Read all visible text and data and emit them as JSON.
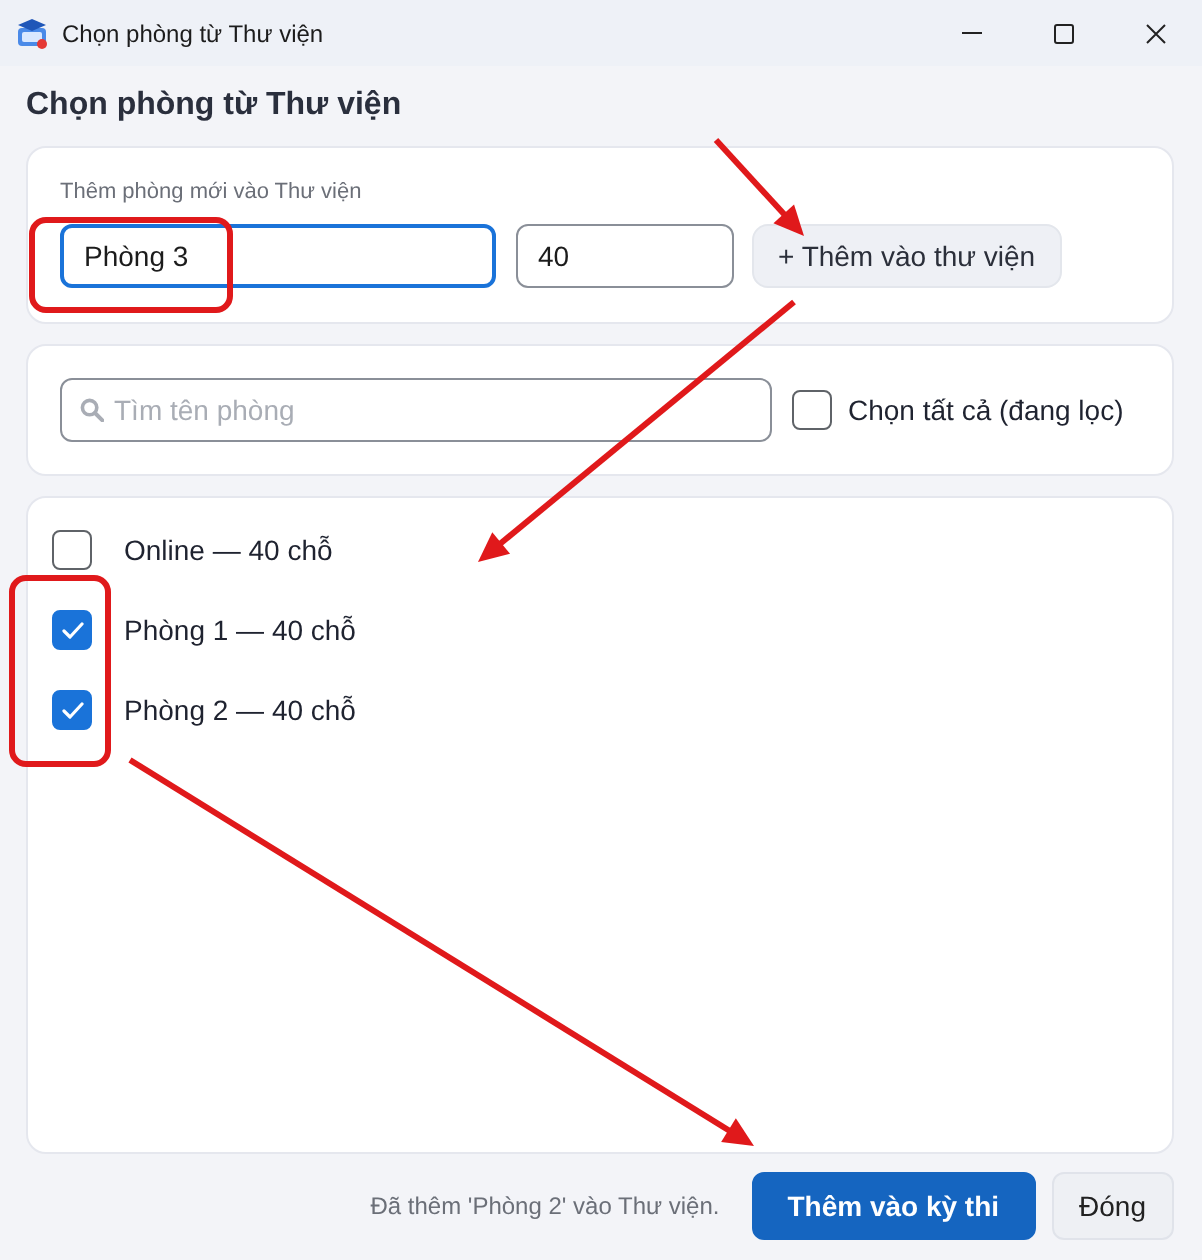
{
  "window": {
    "title": "Chọn phòng từ Thư viện"
  },
  "heading": "Chọn phòng từ Thư viện",
  "add_room": {
    "label": "Thêm phòng mới vào Thư viện",
    "name_field": {
      "value": "Phòng 3",
      "focused": true
    },
    "seats_field": {
      "value": "40",
      "focused": false
    },
    "button": "+ Thêm vào thư viện"
  },
  "filter": {
    "placeholder": "Tìm tên phòng",
    "select_all": {
      "label": "Chọn tất cả (đang lọc)",
      "checked": false
    }
  },
  "rooms": [
    {
      "label": "Online — 40 chỗ",
      "checked": false
    },
    {
      "label": "Phòng 1 — 40 chỗ",
      "checked": true
    },
    {
      "label": "Phòng 2 — 40 chỗ",
      "checked": true
    }
  ],
  "footer": {
    "status": "Đã thêm 'Phòng 2' vào Thư viện.",
    "buttons": [
      {
        "label": "Thêm vào kỳ thi",
        "kind": "primary"
      },
      {
        "label": "Đóng",
        "kind": "secondary"
      }
    ]
  },
  "annotations": [
    {
      "kind": "arrow"
    },
    {
      "kind": "box"
    },
    {
      "kind": "arrow"
    },
    {
      "kind": "arrow"
    },
    {
      "kind": "box"
    }
  ]
}
